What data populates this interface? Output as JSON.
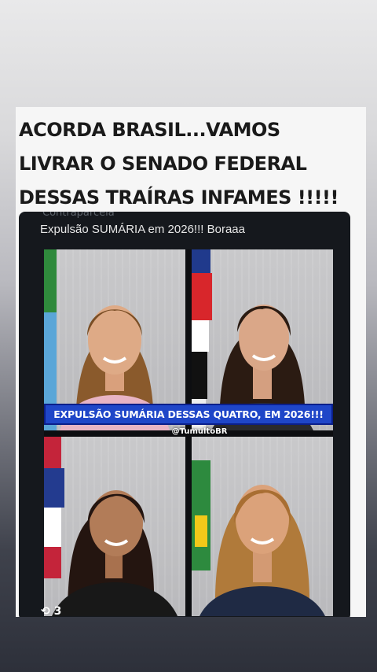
{
  "story": {
    "headline_lines": [
      "ACORDA BRASIL...VAMOS",
      "LIVRAR O SENADO FEDERAL",
      "DESSAS TRAÍRAS INFAMES !!!!!"
    ]
  },
  "post": {
    "author_ghost": "Contraparcela",
    "caption": "Expulsão SUMÁRIA em 2026!!! Boraaa",
    "image": {
      "banner": "EXPULSÃO SUMÁRIA DESSAS QUATRO, EM 2026!!!",
      "watermark": "@TumultoBR"
    },
    "repost_count": "3"
  },
  "colors": {
    "banner_bg": "#1f46c8",
    "post_bg": "#15181d",
    "card_bg": "#f6f6f6"
  },
  "icons": {
    "repost": "repost-icon"
  }
}
